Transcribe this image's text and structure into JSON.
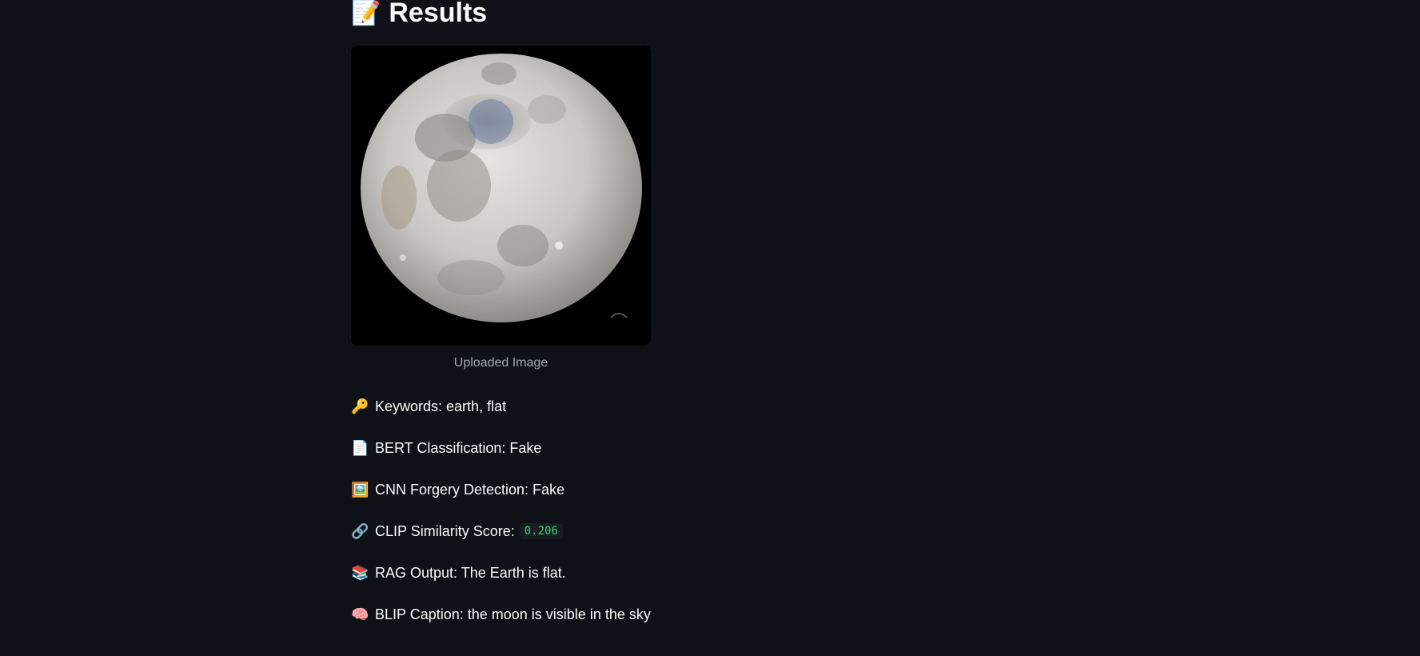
{
  "results": {
    "heading_emoji": "📝",
    "heading": "Results",
    "image_caption": "Uploaded Image",
    "items": [
      {
        "emoji": "🔑",
        "text": "Keywords: earth, flat"
      },
      {
        "emoji": "📄",
        "text": "BERT Classification: Fake"
      },
      {
        "emoji": "🖼️",
        "text": "CNN Forgery Detection: Fake"
      },
      {
        "emoji": "🔗",
        "text": "CLIP Similarity Score:",
        "code": "0.206"
      },
      {
        "emoji": "📚",
        "text": "RAG Output: The Earth is flat."
      },
      {
        "emoji": "🧠",
        "text": "BLIP Caption: the moon is visible in the sky"
      }
    ]
  }
}
